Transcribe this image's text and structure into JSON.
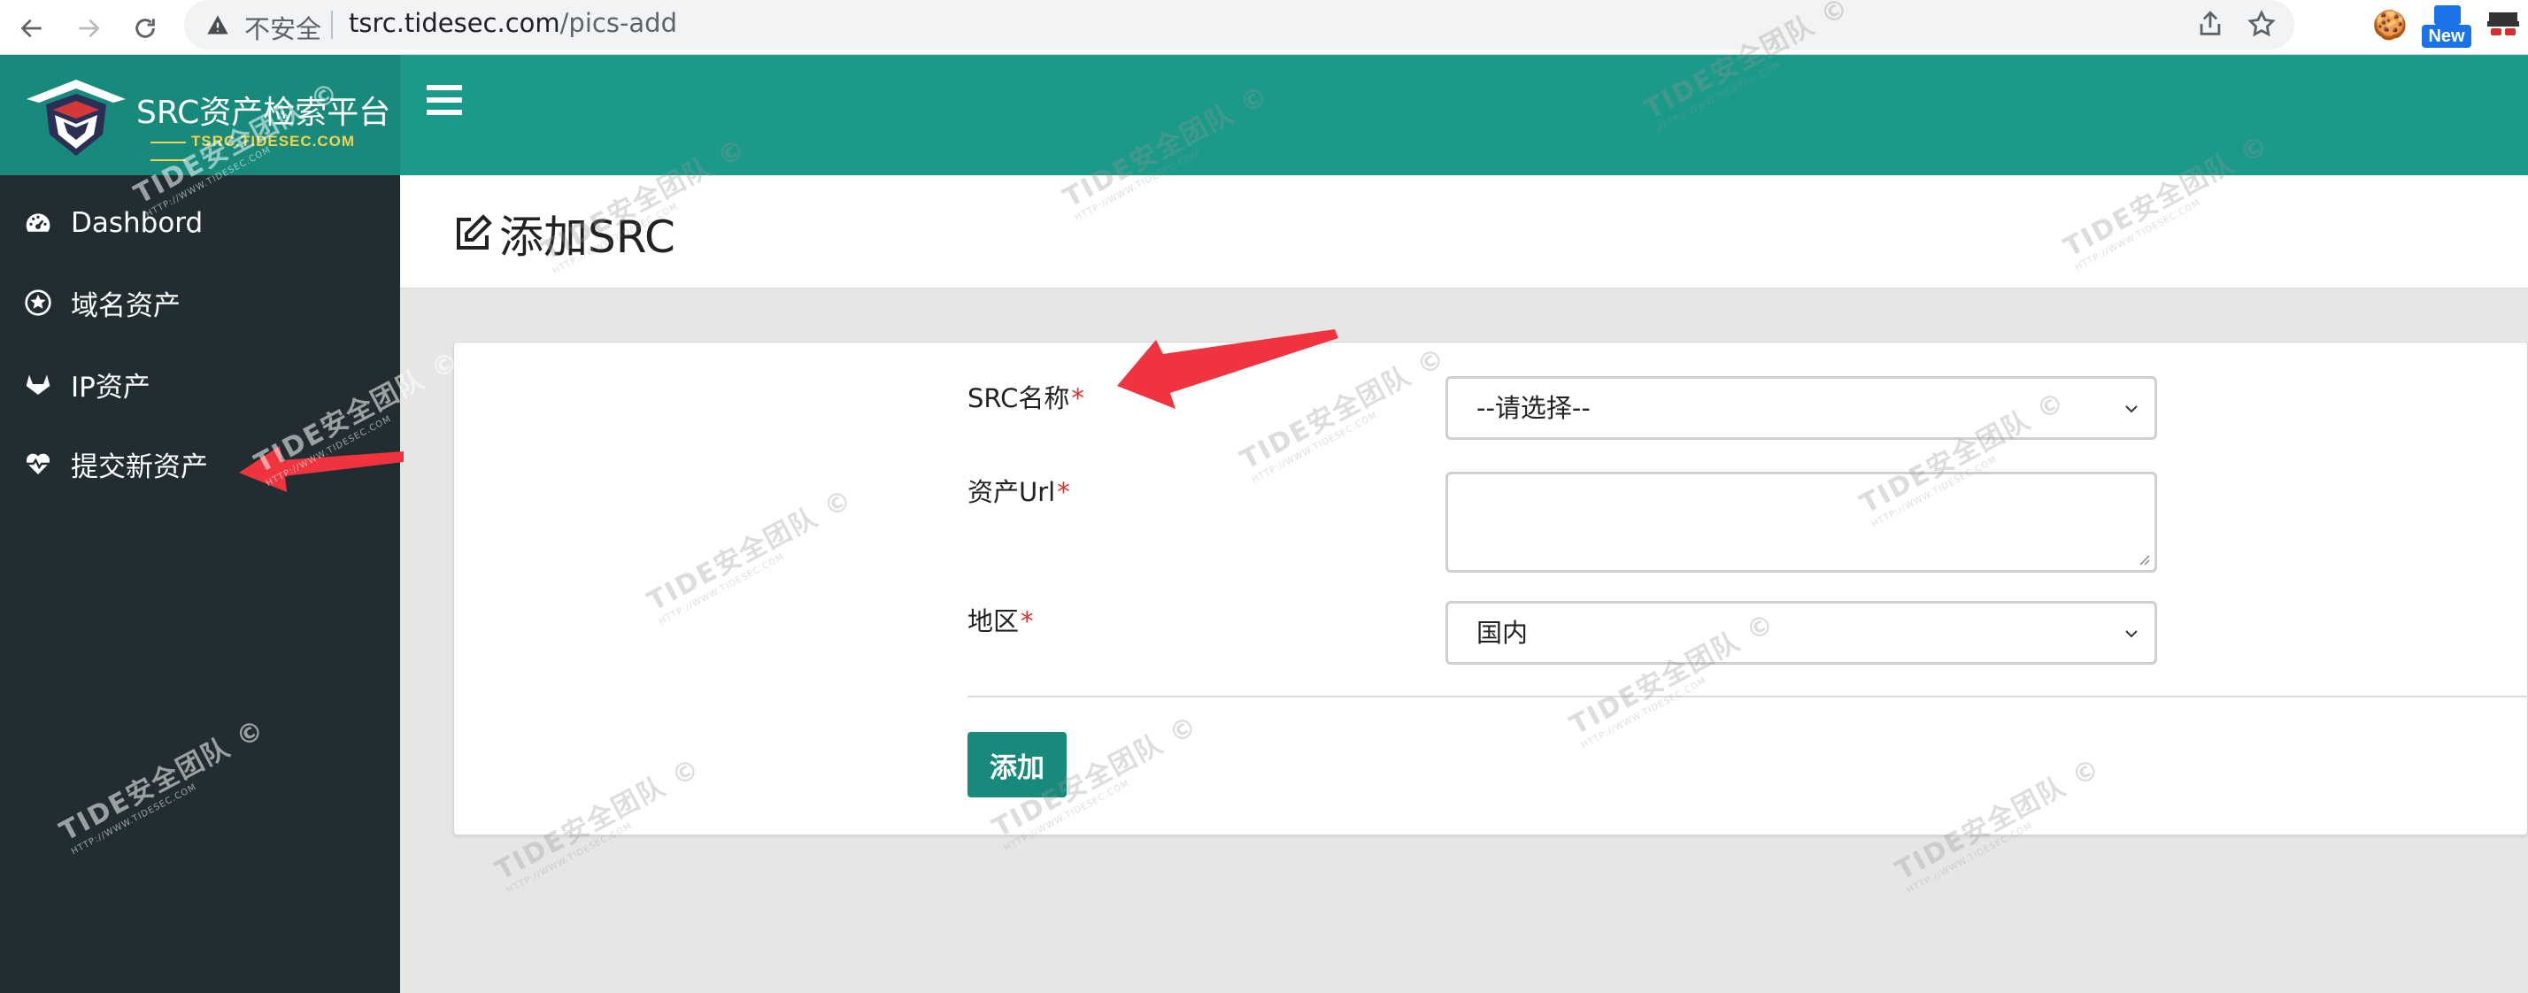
{
  "browser": {
    "insecure_label": "不安全",
    "url_host": "tsrc.tidesec.com",
    "url_path": "/pics-add",
    "extension_badge": "New"
  },
  "brand": {
    "title": "SRC资产检索平台",
    "subtitle": "TSRC.TIDESEC.COM"
  },
  "sidebar": {
    "items": [
      {
        "label": "Dashbord",
        "icon": "dashboard-icon"
      },
      {
        "label": "域名资产",
        "icon": "sheriff-badge-icon"
      },
      {
        "label": "IP资产",
        "icon": "gitlab-icon"
      },
      {
        "label": "提交新资产",
        "icon": "heartbeat-icon"
      }
    ]
  },
  "page": {
    "title": "添加SRC",
    "title_icon": "edit-icon"
  },
  "form": {
    "src_name_label": "SRC名称",
    "src_name_value": "--请选择--",
    "asset_url_label": "资产Url",
    "asset_url_value": "",
    "region_label": "地区",
    "region_value": "国内",
    "required_mark": "*",
    "submit_label": "添加"
  },
  "watermark": {
    "brand": "TIDE安全团队",
    "url": "HTTP://WWW.TIDESEC.COM",
    "symbol": "©"
  },
  "colors": {
    "brand_teal_dark": "#188a7c",
    "brand_teal": "#1b9a8a",
    "sidebar_bg": "#222d32",
    "required_red": "#d9322c",
    "arrow_red": "#f0343f"
  }
}
